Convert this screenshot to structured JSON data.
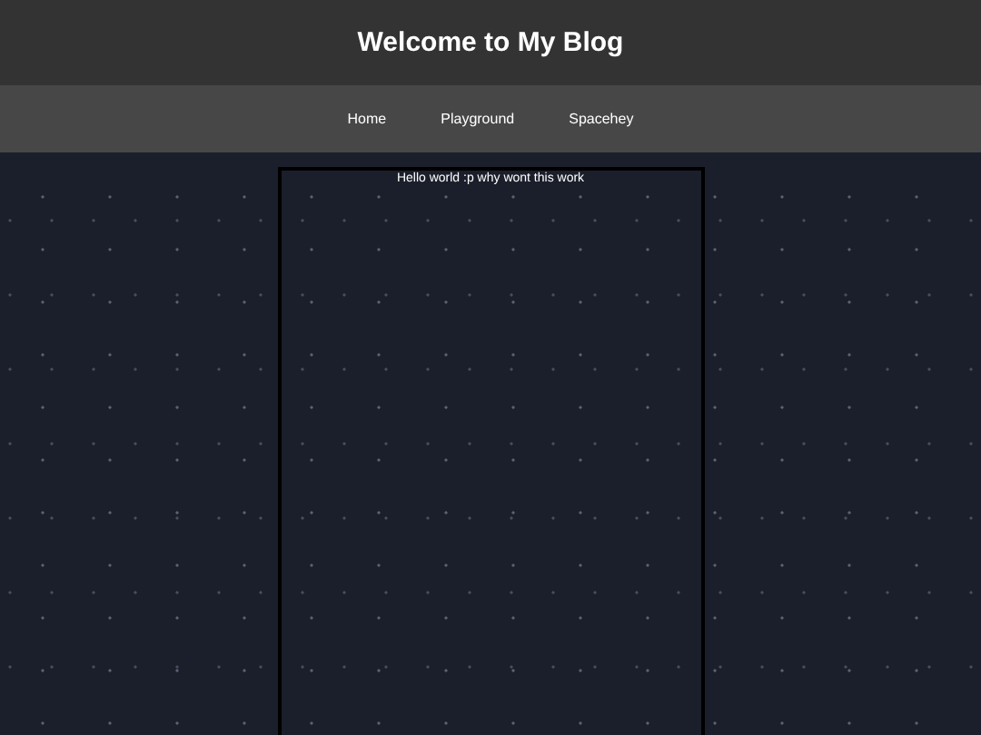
{
  "header": {
    "title": "Welcome to My Blog"
  },
  "nav": {
    "links": [
      "Home",
      "Playground",
      "Spacehey"
    ]
  },
  "content": {
    "text": "Hello world :p why wont this work"
  }
}
